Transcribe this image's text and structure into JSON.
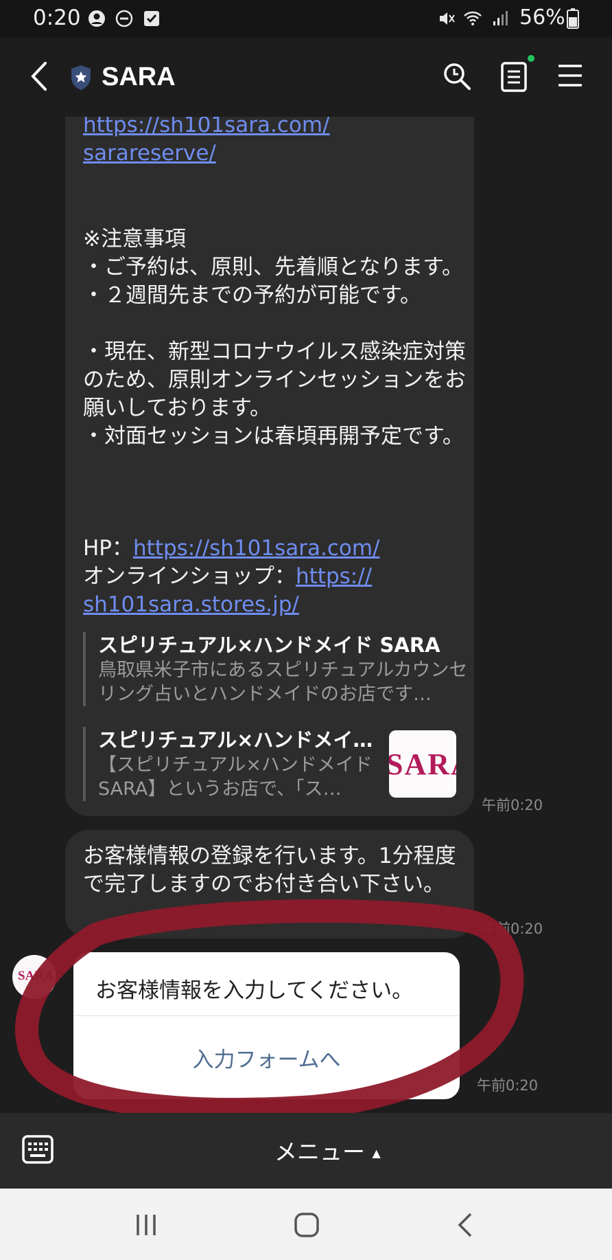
{
  "status_bar": {
    "time": "0:20",
    "battery_percent": "56%",
    "icons": [
      "account-circle-icon",
      "do-not-disturb-icon",
      "checkbox-icon",
      "mute-icon",
      "wifi-icon",
      "signal-icon",
      "battery-icon"
    ]
  },
  "header": {
    "title": "SARA",
    "icons": [
      "back-arrow-icon",
      "shield-star-icon",
      "search-icon",
      "notes-icon",
      "menu-icon"
    ],
    "notification_dot_color": "#22c55e"
  },
  "messages": {
    "first": {
      "url_top_line1": "https://sh101sara.com/",
      "url_top_line2": "sarareserve/",
      "notes_body": "※注意事項\n・ご予約は、原則、先着順となります。\n・２週間先までの予約が可能です。\n\n・現在、新型コロナウイルス感染症対策のため、原則オンラインセッションをお願いしております。\n・対面セッションは春頃再開予定です。",
      "hp_label": "HP：",
      "hp_url": "https://sh101sara.com/",
      "shop_label": "オンラインショップ：",
      "shop_url_line1": "https://",
      "shop_url_line2": "sh101sara.stores.jp/",
      "preview1_title": "スピリチュアル×ハンドメイド SARA",
      "preview1_desc": "鳥取県米子市にあるスピリチュアルカウンセリング占いとハンドメイドのお店です…",
      "preview2_title": "スピリチュアル×ハンドメイ…",
      "preview2_desc": "【スピリチュアル×ハンドメイドSARA】というお店で、「ス…",
      "preview2_thumb_text": "SARA",
      "timestamp": "午前0:20"
    },
    "second": {
      "text": "お客様情報の登録を行います。1分程度で完了しますのでお付き合い下さい。",
      "timestamp": "午前0:20"
    },
    "card": {
      "avatar_text": "SARA",
      "title": "お客様情報を入力してください。",
      "button_label": "入力フォームへ",
      "timestamp": "午前0:20"
    }
  },
  "bottom_bar": {
    "menu_label": "メニュー",
    "menu_arrow": "▲",
    "icons": [
      "keyboard-icon"
    ]
  },
  "nav_bar": {
    "icons": [
      "recent-apps-icon",
      "home-icon",
      "back-icon"
    ]
  },
  "colors": {
    "background": "#1d1d1d",
    "bubble": "#2d2d2d",
    "link": "#6f8df0",
    "card_button": "#4f6c91",
    "annotation_circle": "#8e1a2b"
  }
}
